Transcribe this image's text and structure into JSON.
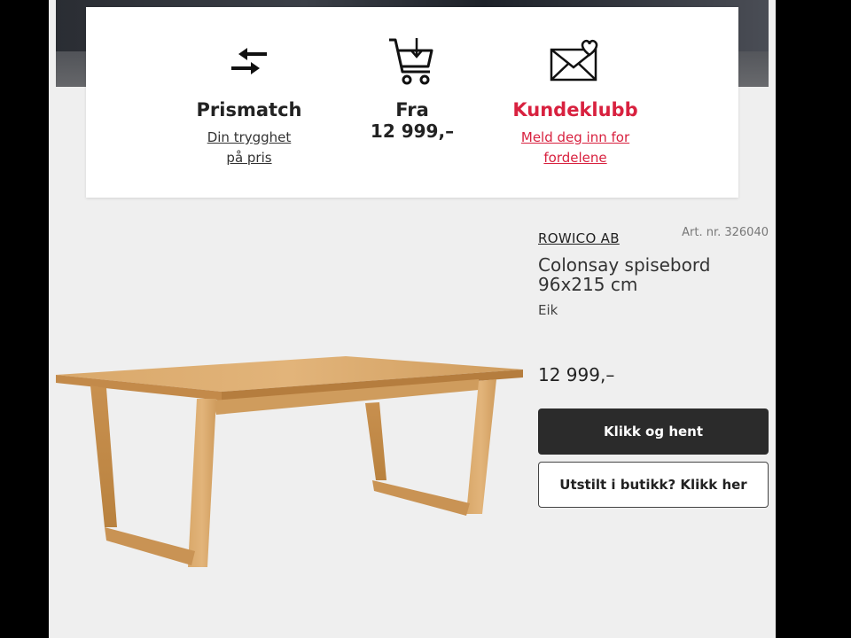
{
  "usp": {
    "prismatch": {
      "title": "Prismatch",
      "link_line1": "Din trygghet",
      "link_line2": "på pris",
      "icon": "arrows-exchange-icon"
    },
    "fra": {
      "title": "Fra",
      "price": "12 999,–",
      "icon": "cart-download-icon"
    },
    "kundeklubb": {
      "title": "Kundeklubb",
      "link_line1": "Meld deg inn for",
      "link_line2": "fordelene",
      "icon": "envelope-heart-icon"
    }
  },
  "product": {
    "brand": "ROWICO AB",
    "art_nr": "Art. nr. 326040",
    "name": "Colonsay spisebord 96x215 cm",
    "variant": "Eik",
    "price": "12 999,–",
    "image_alt": "Colonsay dining table in oak"
  },
  "buttons": {
    "click_collect": "Klikk og hent",
    "in_store": "Utstilt i butikk? Klikk her"
  },
  "colors": {
    "accent": "#d8213f",
    "primary_button": "#2b2b2b",
    "background": "#efefef"
  }
}
